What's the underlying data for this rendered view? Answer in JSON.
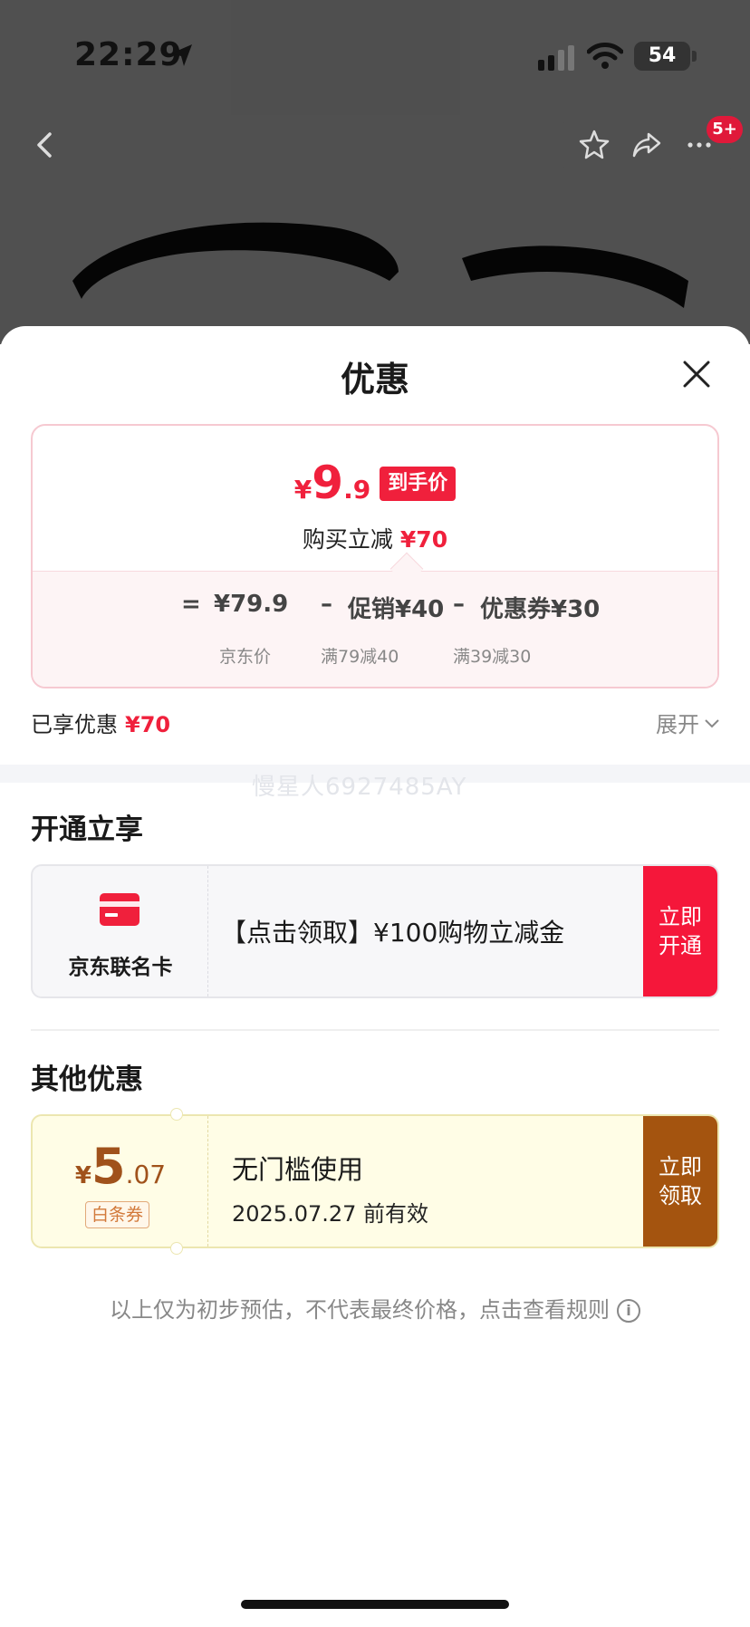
{
  "status_bar": {
    "time": "22:29",
    "battery": "54"
  },
  "header": {
    "badge": "5+"
  },
  "sheet": {
    "title": "优惠"
  },
  "price_card": {
    "currency": "¥",
    "price_int": "9",
    "price_dec": ".9",
    "price_tag": "到手价",
    "save_label": "购买立减",
    "save_value": "¥70",
    "formula": {
      "eq": "=",
      "base_value": "¥79.9",
      "minus": "–",
      "promo": "促销¥40",
      "coupon": "优惠券¥30",
      "base_label": "京东价",
      "promo_label": "满79减40",
      "coupon_label": "满39减30"
    }
  },
  "enjoy": {
    "label": "已享优惠",
    "value": "¥70",
    "expand": "展开"
  },
  "watermark": "慢星人6927485AY",
  "open_section": {
    "title": "开通立享",
    "card_label": "京东联名卡",
    "desc": "【点击领取】¥100购物立减金",
    "button_line1": "立即",
    "button_line2": "开通"
  },
  "other_section": {
    "title": "其他优惠",
    "coupon": {
      "currency": "¥",
      "amount_int": "5",
      "amount_dec": ".07",
      "tag": "白条券",
      "title": "无门槛使用",
      "date": "2025.07.27 前有效",
      "button_line1": "立即",
      "button_line2": "领取"
    }
  },
  "disclaimer": "以上仅为初步预估，不代表最终价格，点击查看规则",
  "colors": {
    "accent_red": "#f0203c",
    "coupon_brown": "#a4540f",
    "card_red": "#f5173a"
  }
}
